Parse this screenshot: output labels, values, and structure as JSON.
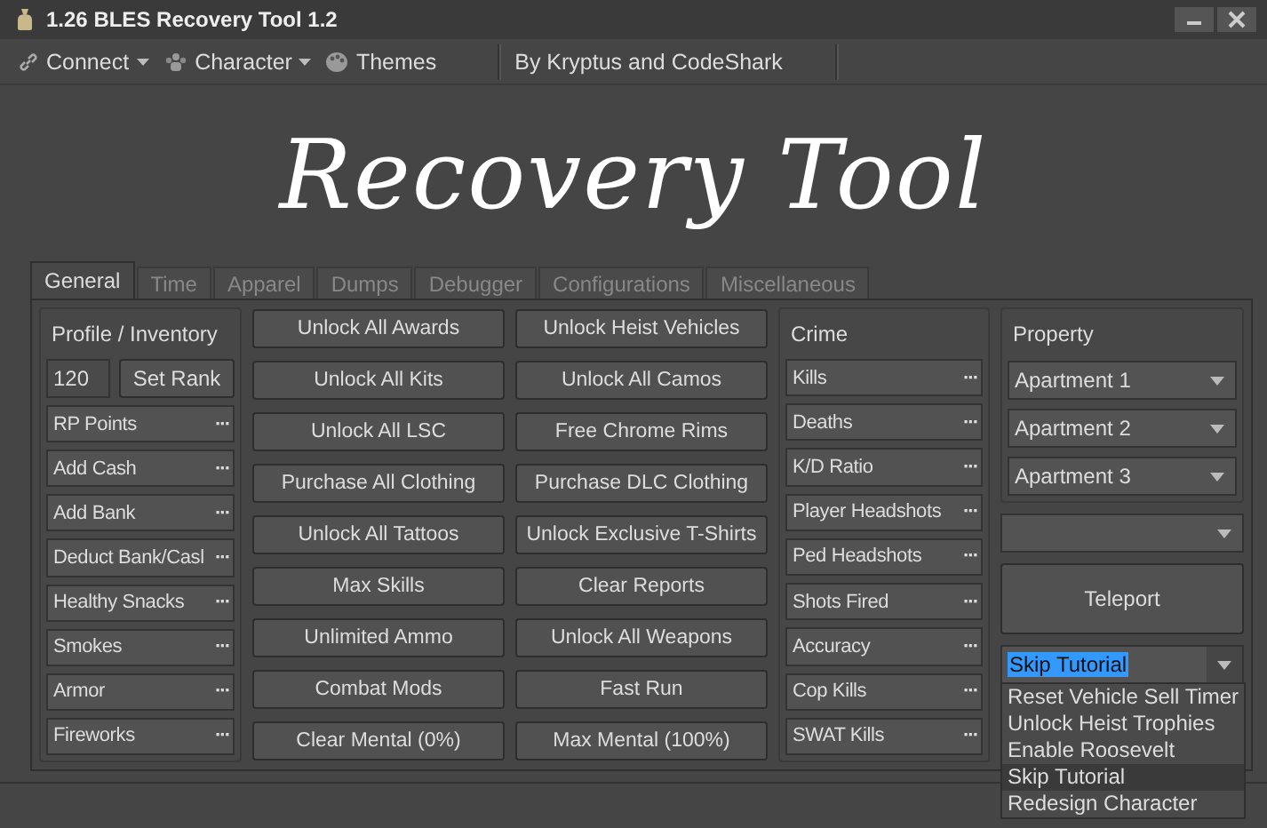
{
  "window": {
    "title": "1.26 BLES Recovery Tool 1.2"
  },
  "toolbar": [
    {
      "label": "Connect",
      "kind": "menu"
    },
    {
      "label": "Character",
      "kind": "menu"
    },
    {
      "label": "Themes",
      "kind": "plain"
    },
    {
      "label": "By Kryptus and CodeShark",
      "kind": "credit"
    }
  ],
  "banner": {
    "title": "Recovery Tool"
  },
  "tabs": [
    {
      "label": "General",
      "selected": true
    },
    {
      "label": "Time",
      "selected": false
    },
    {
      "label": "Apparel",
      "selected": false
    },
    {
      "label": "Dumps",
      "selected": false
    },
    {
      "label": "Debugger",
      "selected": false
    },
    {
      "label": "Configurations",
      "selected": false
    },
    {
      "label": "Miscellaneous",
      "selected": false
    }
  ],
  "profile": {
    "title": "Profile / Inventory",
    "rank_value": "120",
    "rank_button": "Set Rank",
    "rows": [
      {
        "label": "RP Points",
        "action": "···"
      },
      {
        "label": "Add Cash",
        "action": "···"
      },
      {
        "label": "Add Bank",
        "action": "···"
      },
      {
        "label": "Deduct Bank/Casl",
        "action": "···"
      },
      {
        "label": "Healthy Snacks",
        "action": "···"
      },
      {
        "label": "Smokes",
        "action": "···"
      },
      {
        "label": "Armor",
        "action": "···"
      },
      {
        "label": "Fireworks",
        "action": "···"
      }
    ]
  },
  "buttons_left": [
    "Unlock All Awards",
    "Unlock All Kits",
    "Unlock All LSC",
    "Purchase All Clothing",
    "Unlock All Tattoos",
    "Max Skills",
    "Unlimited Ammo",
    "Combat Mods",
    "Clear Mental (0%)"
  ],
  "buttons_right": [
    "Unlock Heist Vehicles",
    "Unlock All Camos",
    "Free Chrome Rims",
    "Purchase DLC Clothing",
    "Unlock Exclusive T-Shirts",
    "Clear Reports",
    "Unlock All Weapons",
    "Fast Run",
    "Max Mental (100%)"
  ],
  "crime": {
    "title": "Crime",
    "rows": [
      {
        "label": "Kills",
        "action": "···"
      },
      {
        "label": "Deaths",
        "action": "···"
      },
      {
        "label": "K/D Ratio",
        "action": "···"
      },
      {
        "label": "Player Headshots",
        "action": "···"
      },
      {
        "label": "Ped Headshots",
        "action": "···"
      },
      {
        "label": "Shots Fired",
        "action": "···"
      },
      {
        "label": "Accuracy",
        "action": "···"
      },
      {
        "label": "Cop Kills",
        "action": "···"
      },
      {
        "label": "SWAT Kills",
        "action": "···"
      }
    ]
  },
  "property": {
    "title": "Property",
    "apartments": [
      "Apartment 1",
      "Apartment 2",
      "Apartment 3"
    ]
  },
  "teleport_button": "Teleport",
  "options_dropdown": {
    "value": "Skip Tutorial",
    "expanded": true,
    "options": [
      {
        "label": "Reset Vehicle Sell Timer",
        "selected": false
      },
      {
        "label": "Unlock Heist Trophies",
        "selected": false
      },
      {
        "label": "Enable Roosevelt",
        "selected": false
      },
      {
        "label": "Skip Tutorial",
        "selected": true
      },
      {
        "label": "Redesign Character",
        "selected": false
      }
    ]
  }
}
